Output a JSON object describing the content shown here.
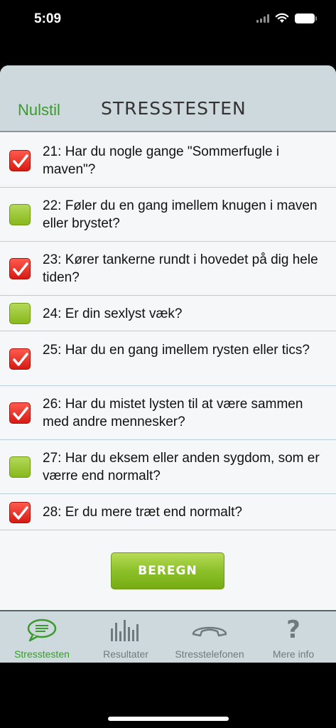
{
  "status_bar": {
    "time": "5:09"
  },
  "nav": {
    "reset_label": "Nulstil",
    "title": "STRESSTESTEN"
  },
  "questions": [
    {
      "text": "21: Har du nogle gange \"Sommerfugle i maven\"?",
      "checked": true
    },
    {
      "text": "22: Føler du en gang imellem knugen i maven eller brystet?",
      "checked": false
    },
    {
      "text": "23: Kører tankerne rundt i hovedet på dig hele tiden?",
      "checked": true
    },
    {
      "text": "24: Er din sexlyst væk?",
      "checked": false
    },
    {
      "text": "25: Har du en gang imellem rysten eller tics?",
      "checked": true
    },
    {
      "text": "26: Har du mistet lysten til at være sammen med andre mennesker?",
      "checked": true
    },
    {
      "text": "27: Har du eksem eller anden sygdom, som er værre end normalt?",
      "checked": false
    },
    {
      "text": "28: Er du mere træt end normalt?",
      "checked": true
    }
  ],
  "calculate_button": {
    "label": "BEREGN"
  },
  "tabs": [
    {
      "label": "Stresstesten",
      "icon": "chat-bubble-icon",
      "active": true
    },
    {
      "label": "Resultater",
      "icon": "bar-chart-icon",
      "active": false
    },
    {
      "label": "Stresstelefonen",
      "icon": "phone-icon",
      "active": false
    },
    {
      "label": "Mere info",
      "icon": "question-mark-icon",
      "active": false
    }
  ],
  "colors": {
    "accent_green": "#3c9a2e",
    "checked_red": "#d71b14",
    "unchecked_green": "#88b81c",
    "bar_gray": "#cdd9dc"
  }
}
